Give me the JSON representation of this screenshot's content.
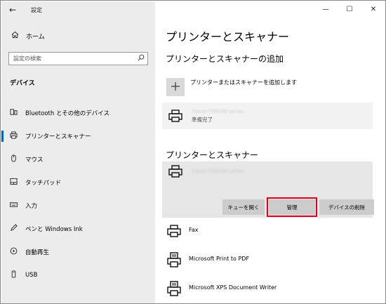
{
  "window": {
    "title": "設定",
    "controls": {
      "minimize": "—",
      "maximize": "☐",
      "close": "✕"
    }
  },
  "sidebar": {
    "back_glyph": "←",
    "home": {
      "icon": "home-icon",
      "label": "ホーム"
    },
    "search": {
      "placeholder": "設定の検索",
      "icon": "search-icon"
    },
    "section": "デバイス",
    "items": [
      {
        "icon": "bluetooth-icon",
        "label": "Bluetooth とその他のデバイス",
        "active": false
      },
      {
        "icon": "printer-icon",
        "label": "プリンターとスキャナー",
        "active": true
      },
      {
        "icon": "mouse-icon",
        "label": "マウス",
        "active": false
      },
      {
        "icon": "touchpad-icon",
        "label": "タッチパッド",
        "active": false
      },
      {
        "icon": "keyboard-icon",
        "label": "入力",
        "active": false
      },
      {
        "icon": "pen-icon",
        "label": "ペンと Windows Ink",
        "active": false
      },
      {
        "icon": "autoplay-icon",
        "label": "自動再生",
        "active": false
      },
      {
        "icon": "usb-icon",
        "label": "USB",
        "active": false
      }
    ]
  },
  "main": {
    "title": "プリンターとスキャナー",
    "add_section": {
      "heading": "プリンターとスキャナーの追加",
      "add_label": "プリンターまたはスキャナーを追加します"
    },
    "found_printer": {
      "name": "Canon TS6330 series",
      "status": "準備完了"
    },
    "list_section": {
      "heading": "プリンターとスキャナー",
      "selected": {
        "name": "Canon TS6330 series",
        "buttons": {
          "queue": "キューを開く",
          "manage": "管理",
          "remove": "デバイスの削除"
        }
      },
      "printers": [
        {
          "icon": "fax-printer-icon",
          "label": "Fax"
        },
        {
          "icon": "pdf-printer-icon",
          "label": "Microsoft Print to PDF"
        },
        {
          "icon": "xps-printer-icon",
          "label": "Microsoft XPS Document Writer"
        }
      ]
    }
  }
}
